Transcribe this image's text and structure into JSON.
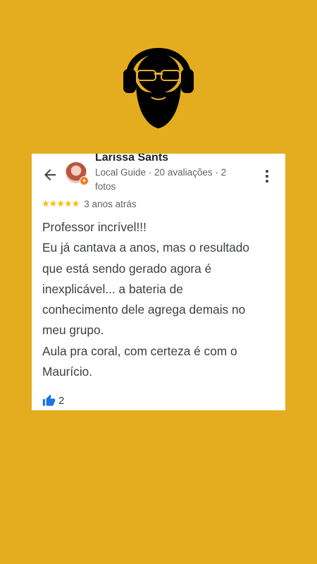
{
  "brand": {
    "logo_icon": "bearded-man-headphones-icon"
  },
  "review": {
    "author_name": "Larissa Sants",
    "author_meta": "Local Guide · 20 avaliações · 2 fotos",
    "rating": 5,
    "stars": "★★★★★",
    "date": "3 anos atrás",
    "text_lines": [
      "Professor incrível!!!",
      "Eu já cantava a anos, mas o resultado",
      "que está sendo gerado agora é",
      "inexplicável... a bateria de",
      "conhecimento dele agrega demais no",
      "meu grupo.",
      "Aula pra coral, com certeza é com o",
      "Maurício."
    ],
    "likes": "2"
  },
  "icons": {
    "back": "arrow-left-icon",
    "more": "more-vert-icon",
    "like": "thumbs-up-icon",
    "badge": "local-guide-badge-icon"
  },
  "colors": {
    "background": "#e4ad1f",
    "card": "#ffffff",
    "stars": "#fbbc04",
    "like": "#1a73e8"
  }
}
